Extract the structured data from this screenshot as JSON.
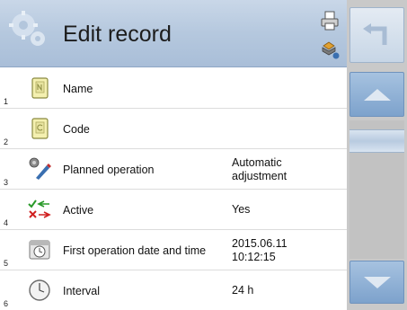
{
  "header": {
    "title": "Edit record",
    "icons": {
      "main": "gears-icon",
      "print": "printer-icon",
      "settings": "settings-flask-icon"
    }
  },
  "rows": [
    {
      "number": "1",
      "label": "Name",
      "value": "",
      "icon": "name-field-icon"
    },
    {
      "number": "2",
      "label": "Code",
      "value": "",
      "icon": "code-field-icon"
    },
    {
      "number": "3",
      "label": "Planned operation",
      "value": "Automatic\nadjustment",
      "icon": "planned-operation-icon"
    },
    {
      "number": "4",
      "label": "Active",
      "value": "Yes",
      "icon": "active-toggle-icon"
    },
    {
      "number": "5",
      "label": "First operation date and time",
      "value": "2015.06.11\n10:12:15",
      "icon": "calendar-clock-icon"
    },
    {
      "number": "6",
      "label": "Interval",
      "value": "24 h",
      "icon": "clock-icon"
    }
  ],
  "side": {
    "icons": {
      "back": "back-arrow-icon",
      "up": "arrow-up-icon",
      "down": "arrow-down-icon"
    }
  },
  "colors": {
    "header_bg": "#b5c8de",
    "button_blue": "#7da2cc",
    "side_bg": "#c9c9c9",
    "text": "#111111"
  }
}
